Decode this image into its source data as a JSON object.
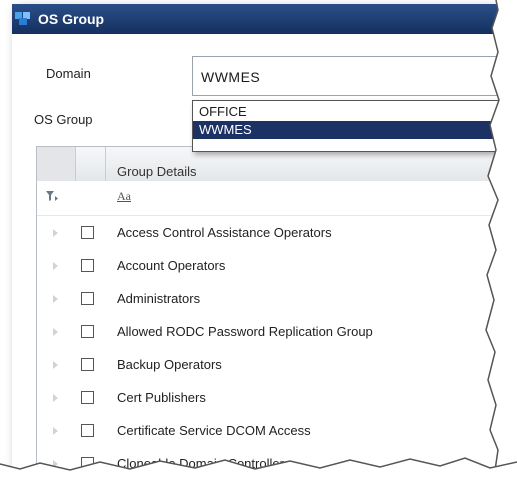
{
  "window": {
    "title": "OS Group"
  },
  "form": {
    "domain_label": "Domain",
    "domain_value": "WWMES",
    "osgroup_label": "OS Group"
  },
  "dropdown": {
    "options": [
      "OFFICE",
      "WWMES"
    ],
    "selected": "WWMES"
  },
  "grid": {
    "header": "Group Details",
    "filter_icon": "filter-icon",
    "text_filter_icon": "Aa",
    "rows": [
      "Access Control Assistance Operators",
      "Account Operators",
      "Administrators",
      "Allowed RODC Password Replication Group",
      "Backup Operators",
      "Cert Publishers",
      "Certificate Service DCOM Access",
      "Cloneable Domain Controllers"
    ]
  },
  "colors": {
    "titlebar": "#1e3f74",
    "selection": "#1c3264"
  }
}
